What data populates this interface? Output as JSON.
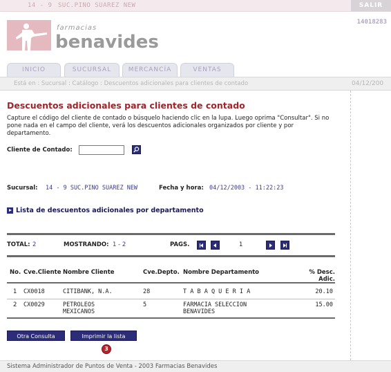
{
  "topbar": {
    "store_number": "14 - 9",
    "store_name": "SUC.PINO SUAREZ NEW",
    "logout_label": "SALIR"
  },
  "header": {
    "logo_text_small": "farmacias",
    "logo_text_big": "benavides",
    "session_code": "14018283"
  },
  "tabs": [
    {
      "label": "INICIO"
    },
    {
      "label": "SUCURSAL"
    },
    {
      "label": "MERCANCÍA"
    },
    {
      "label": "VENTAS"
    }
  ],
  "breadcrumb": {
    "text": "Está en : Sucursal : Catálogo : Descuentos adicionales para clientes de contado",
    "date": "04/12/200"
  },
  "page": {
    "title": "Descuentos adicionales para clientes de contado",
    "intro": "Capture el código del cliente de contado o búsquelo haciendo clic en la lupa. Luego oprima \"Consultar\". Si no pone nada en el campo del cliente, verá los descuentos adicionales organizados por cliente y por departamento.",
    "client_label": "Cliente de Contado:",
    "client_value": "",
    "sucursal_label": "Sucursal:",
    "sucursal_value": "14 - 9 SUC.PINO SUAREZ NEW",
    "fecha_label": "Fecha y hora:",
    "fecha_value": "04/12/2003 - 11:22:23",
    "list_link": "Lista de descuentos adicionales por departamento"
  },
  "pager": {
    "total_label": "TOTAL:",
    "total_value": "2",
    "showing_label": "MOSTRANDO:",
    "showing_value": "1 - 2",
    "pages_label": "PAGS.",
    "current_page": "1"
  },
  "table": {
    "headers": {
      "no": "No.",
      "cve_cliente": "Cve.Cliente",
      "nombre_cliente": "Nombre Cliente",
      "cve_depto": "Cve.Depto.",
      "nombre_depto": "Nombre Departamento",
      "desc_line1": "% Desc.",
      "desc_line2": "Adic."
    },
    "rows": [
      {
        "no": "1",
        "cve_cliente": "CX0018",
        "nombre_cliente_1": "CITIBANK, N.A.",
        "nombre_cliente_2": "",
        "cve_depto": "28",
        "nombre_depto_1": "T A B A Q U E R I A",
        "nombre_depto_2": "",
        "desc": "20.10"
      },
      {
        "no": "2",
        "cve_cliente": "CX0029",
        "nombre_cliente_1": "PETROLEOS",
        "nombre_cliente_2": "MEXICANOS",
        "cve_depto": "5",
        "nombre_depto_1": "FARMACIA SELECCION",
        "nombre_depto_2": "BENAVIDES",
        "desc": "15.00"
      }
    ]
  },
  "buttons": {
    "otra_consulta": "Otra Consulta",
    "imprimir": "Imprimir la lista",
    "badge": "3"
  },
  "footer": {
    "text": "Sistema Administrador de Puntos de Venta - 2003 Farmacias Benavides"
  },
  "colors": {
    "brand_red": "#a3232a",
    "brand_navy": "#2c2c78",
    "logo_pink": "#e4b9bf",
    "logo_gray": "#9a9a9a"
  }
}
